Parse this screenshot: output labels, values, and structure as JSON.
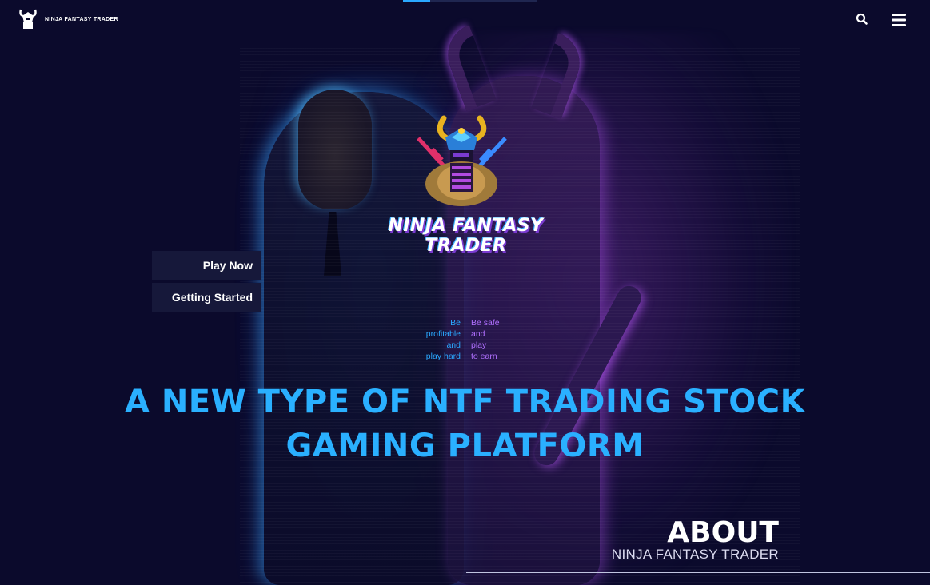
{
  "header": {
    "brand_text": "NINJA FANTASY TRADER",
    "search_icon": "search-icon",
    "menu_icon": "hamburger-menu-icon"
  },
  "hero": {
    "logo_title": "NINJA FANTASY TRADER",
    "play_label": "Play Now",
    "start_label": "Getting Started",
    "tagline_left": [
      "Be",
      "profitable",
      "and",
      "play hard"
    ],
    "tagline_right": [
      "Be safe",
      "and",
      "play",
      "to earn"
    ],
    "headline_line1": "A NEW TYPE OF NTF TRADING STOCK",
    "headline_line2": "GAMING PLATFORM"
  },
  "about": {
    "title": "ABOUT",
    "subtitle": "NINJA FANTASY TRADER"
  },
  "colors": {
    "background": "#0b0a2c",
    "accent_blue": "#2ab0ff",
    "accent_purple": "#b070ff",
    "button_bg": "#16183a"
  }
}
